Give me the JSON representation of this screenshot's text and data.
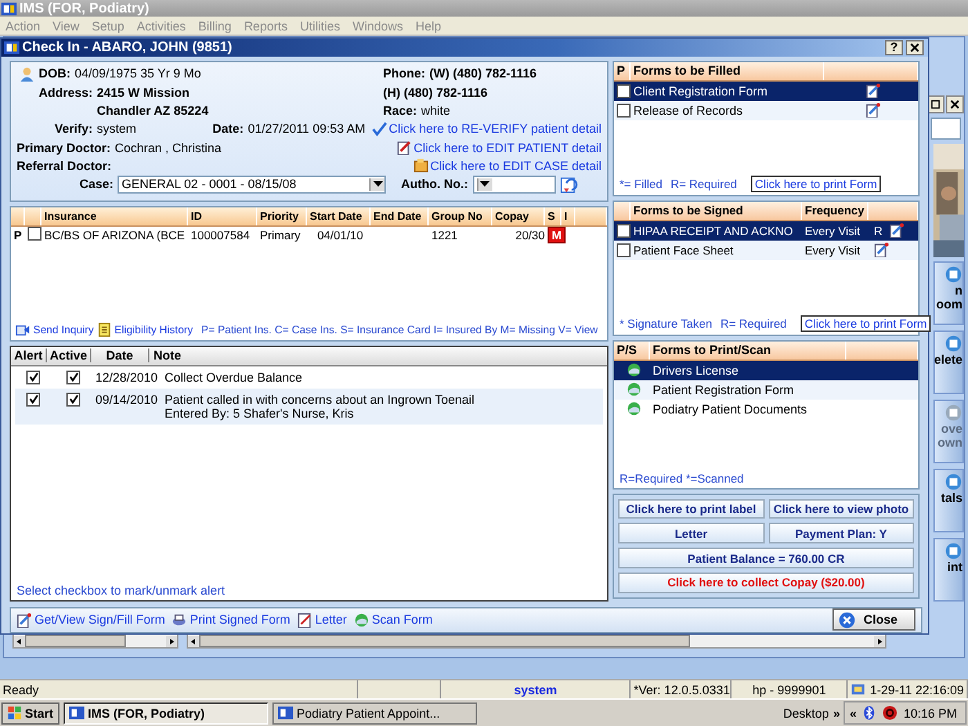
{
  "app": {
    "title": "IMS (FOR, Podiatry)",
    "menu": [
      {
        "label": "Action",
        "disabled": true
      },
      {
        "label": "View",
        "disabled": true
      },
      {
        "label": "Setup",
        "disabled": true
      },
      {
        "label": "Activities",
        "disabled": true
      },
      {
        "label": "Billing",
        "disabled": true
      },
      {
        "label": "Reports",
        "disabled": true
      },
      {
        "label": "Utilities",
        "disabled": true
      },
      {
        "label": "Windows",
        "disabled": true
      },
      {
        "label": "Help",
        "disabled": true
      }
    ]
  },
  "background_window": {
    "side_buttons": [
      {
        "lines": [
          "n",
          "oom"
        ],
        "disabled": false
      },
      {
        "lines": [
          "elete"
        ],
        "disabled": false
      },
      {
        "lines": [
          "ove",
          "own"
        ],
        "disabled": true
      },
      {
        "lines": [
          "tals"
        ],
        "disabled": false
      },
      {
        "lines": [
          "int"
        ],
        "disabled": false
      }
    ]
  },
  "dialog": {
    "title": "Check In - ABARO, JOHN (9851)",
    "help": "?"
  },
  "patient": {
    "dob_label": "DOB:",
    "dob": "04/09/1975  35 Yr 9 Mo",
    "phone_label": "Phone:",
    "phone_work": "(W) (480) 782-1116",
    "address_label": "Address:",
    "address_line1": "2415 W Mission",
    "phone_home": "(H) (480) 782-1116",
    "address_line2": "Chandler  AZ  85224",
    "race_label": "Race:",
    "race": "white",
    "verify_label": "Verify:",
    "verify": "system",
    "date_label": "Date:",
    "date": "01/27/2011 09:53 AM",
    "primary_doctor_label": "Primary Doctor:",
    "primary_doctor": "Cochran , Christina",
    "referral_doctor_label": "Referral Doctor:",
    "links": [
      {
        "kind": "verify",
        "label": "Click here to RE-VERIFY patient detail"
      },
      {
        "kind": "edit_patient",
        "label": "Click here to EDIT PATIENT detail"
      },
      {
        "kind": "edit_case",
        "label": "Click here to EDIT CASE detail"
      }
    ],
    "case_label": "Case:",
    "case": "GENERAL 02  -  0001 - 08/15/08",
    "autho_label": "Autho. No.:"
  },
  "insurance": {
    "columns": [
      "Insurance",
      "ID",
      "Priority",
      "Start Date",
      "End Date",
      "Group No",
      "Copay",
      "S",
      "I"
    ],
    "rows": [
      {
        "type": "P",
        "checked": false,
        "insurance": "BC/BS OF ARIZONA  (BCE",
        "id": "100007584",
        "priority": "Primary",
        "start_date": "04/01/10",
        "group_no": "1221",
        "copay": "20/30",
        "s": "M"
      }
    ],
    "send_inquiry": "Send Inquiry",
    "eligibility_history": "Eligibility History",
    "legend": "P= Patient Ins. C= Case Ins.  S= Insurance Card   I= Insured By   M= Missing   V= View"
  },
  "alerts": {
    "columns": [
      "Alert",
      "Active",
      "Date",
      "Note"
    ],
    "rows": [
      {
        "alert": true,
        "active": true,
        "date": "12/28/2010",
        "note": [
          "Collect Overdue Balance"
        ]
      },
      {
        "alert": true,
        "active": true,
        "date": "09/14/2010",
        "note": [
          "Patient called in with concerns about an Ingrown Toenail",
          "Entered By: 5 Shafer's Nurse, Kris"
        ]
      }
    ],
    "hint": "Select checkbox to mark/unmark alert"
  },
  "forms_filled": {
    "columns": [
      "P",
      "Forms to be Filled"
    ],
    "rows": [
      {
        "name": "Client Registration Form",
        "checked": false,
        "selected": true
      },
      {
        "name": "Release of Records",
        "checked": false,
        "selected": false
      }
    ],
    "legend": [
      "*= Filled",
      "R= Required"
    ],
    "print": "Click here to print Form"
  },
  "forms_signed": {
    "columns": [
      "Forms to be Signed",
      "Frequency"
    ],
    "rows": [
      {
        "name": "HIPAA RECEIPT AND ACKNO",
        "frequency": "Every Visit",
        "required": "R",
        "checked": false,
        "selected": true
      },
      {
        "name": "Patient Face Sheet",
        "frequency": "Every Visit",
        "checked": false,
        "selected": false
      }
    ],
    "legend": [
      "* Signature Taken",
      "R= Required"
    ],
    "print": "Click here to print Form"
  },
  "forms_print": {
    "columns": [
      "P/S",
      "Forms to Print/Scan"
    ],
    "rows": [
      {
        "name": "Drivers License",
        "selected": true
      },
      {
        "name": "Patient Registration Form",
        "selected": false
      },
      {
        "name": "Podiatry Patient Documents",
        "selected": false
      }
    ],
    "legend": "R=Required  *=Scanned"
  },
  "actions": [
    {
      "label": "Click here to print label",
      "kind": "normal"
    },
    {
      "label": "Click here to view photo",
      "kind": "normal"
    },
    {
      "label": "Letter",
      "kind": "normal"
    },
    {
      "label": "Payment Plan: Y",
      "kind": "normal"
    },
    {
      "label": "Patient Balance = 760.00 CR",
      "kind": "wide"
    },
    {
      "label": "Click here to collect Copay ($20.00)",
      "kind": "alert"
    }
  ],
  "toolbar": [
    {
      "kind": "sign",
      "label": "Get/View Sign/Fill Form"
    },
    {
      "kind": "print",
      "label": "Print Signed Form"
    },
    {
      "kind": "letter",
      "label": "Letter"
    },
    {
      "kind": "scan",
      "label": "Scan Form"
    }
  ],
  "close": "Close",
  "status_bar": [
    {
      "text": "Ready",
      "kind": "plain"
    },
    {
      "text": "system",
      "kind": "user"
    },
    {
      "text": "*Ver: 12.0.5.0331",
      "kind": "plain"
    },
    {
      "text": "hp - 9999901",
      "kind": "plain"
    },
    {
      "text": "1-29-11 22:16:09",
      "kind": "clock"
    }
  ],
  "taskbar": {
    "start": "Start",
    "tasks": [
      {
        "label": "IMS (FOR, Podiatry)",
        "selected": true
      },
      {
        "label": "Podiatry Patient Appoint...",
        "selected": false
      }
    ],
    "desktop": "Desktop",
    "expand": "»",
    "collapse": "«",
    "time": "10:16 PM"
  }
}
